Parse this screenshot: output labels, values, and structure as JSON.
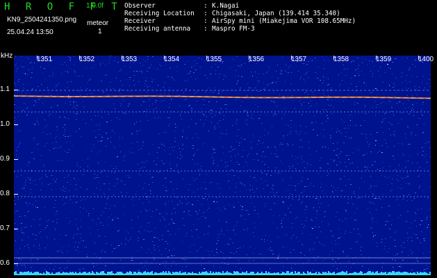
{
  "header": {
    "title": "H R O F F T",
    "version": "1.0.0f",
    "filename": "KN9_2504241350.png",
    "meteor_label": "meteor",
    "datetime": "25.04.24 13:50",
    "meteor_count": "1",
    "info_rows": [
      {
        "label": "Observer",
        "value": "K.Nagai"
      },
      {
        "label": "Receiving Location",
        "value": "Chigasaki, Japan (139.414 35.340)"
      },
      {
        "label": "Receiver",
        "value": "AirSpy mini (Miakejima VOR 108.65MHz)"
      },
      {
        "label": "Receiving antenna",
        "value": "Maspro FM-3"
      }
    ]
  },
  "spectrogram": {
    "y_unit": "kHz",
    "x_ticks": [
      "1351",
      "1352",
      "1353",
      "1354",
      "1355",
      "1356",
      "1357",
      "1358",
      "1359",
      "1400"
    ],
    "y_ticks": [
      "1.1",
      "1.0",
      "0.9",
      "0.8",
      "0.7",
      "0.6"
    ],
    "colors": {
      "background": "#000000",
      "plot": "#00138f",
      "noise": "#4d6bff",
      "carrier": "#ff6a3d",
      "carrier_alt": "#9cff63",
      "line": "#8fd6ff",
      "baseline": "#35d7ff"
    }
  }
}
